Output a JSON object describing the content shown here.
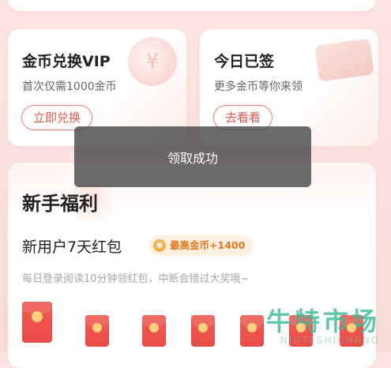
{
  "vip_card": {
    "title": "金币兑换VIP",
    "subtitle": "首次仅需1000金币",
    "button": "立即兑换"
  },
  "sign_card": {
    "title": "今日已签",
    "subtitle": "更多金币等你来领",
    "button": "去看看"
  },
  "toast": {
    "text": "领取成功"
  },
  "welfare": {
    "title": "新手福利",
    "redpack_title": "新用户7天红包",
    "badge": "最高金币+1400",
    "description": "每日登录阅读10分钟领红包，中断会错过大奖哦~"
  },
  "watermark": {
    "text": "牛特市场",
    "sub": "NIUTESHICHANG"
  },
  "colors": {
    "accent": "#e2564c",
    "envelope": "#ea4b45",
    "badge": "#e5781f"
  }
}
